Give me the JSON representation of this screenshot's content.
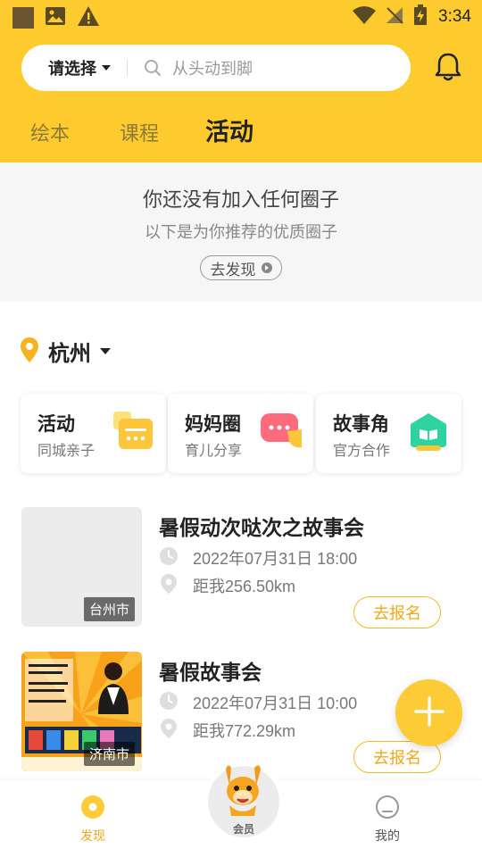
{
  "status_bar": {
    "time": "3:34"
  },
  "search": {
    "region_label": "请选择",
    "placeholder": "从头动到脚"
  },
  "tabs": [
    {
      "label": "绘本"
    },
    {
      "label": "课程"
    },
    {
      "label": "活动",
      "active": true
    }
  ],
  "empty_state": {
    "title": "你还没有加入任何圈子",
    "subtitle": "以下是为你推荐的优质圈子",
    "button_label": "去发现"
  },
  "location": {
    "city": "杭州"
  },
  "categories": [
    {
      "title": "活动",
      "subtitle": "同城亲子",
      "icon": "activity-icon"
    },
    {
      "title": "妈妈圈",
      "subtitle": "育儿分享",
      "icon": "chat-bubble-icon"
    },
    {
      "title": "故事角",
      "subtitle": "官方合作",
      "icon": "book-icon"
    }
  ],
  "activities": [
    {
      "title": "暑假动次哒次之故事会",
      "datetime": "2022年07月31日 18:00",
      "distance": "距我256.50km",
      "city_tag": "台州市",
      "signup_label": "去报名"
    },
    {
      "title": "暑假故事会",
      "datetime": "2022年07月31日 10:00",
      "distance": "距我772.29km",
      "city_tag": "济南市",
      "signup_label": "去报名"
    }
  ],
  "bottom_nav": {
    "discover": "发现",
    "member": "会员",
    "mine": "我的"
  },
  "colors": {
    "brand_yellow": "#fecb2f",
    "signup_orange": "#f0a81a",
    "panel_gray": "#f6f6f7"
  }
}
